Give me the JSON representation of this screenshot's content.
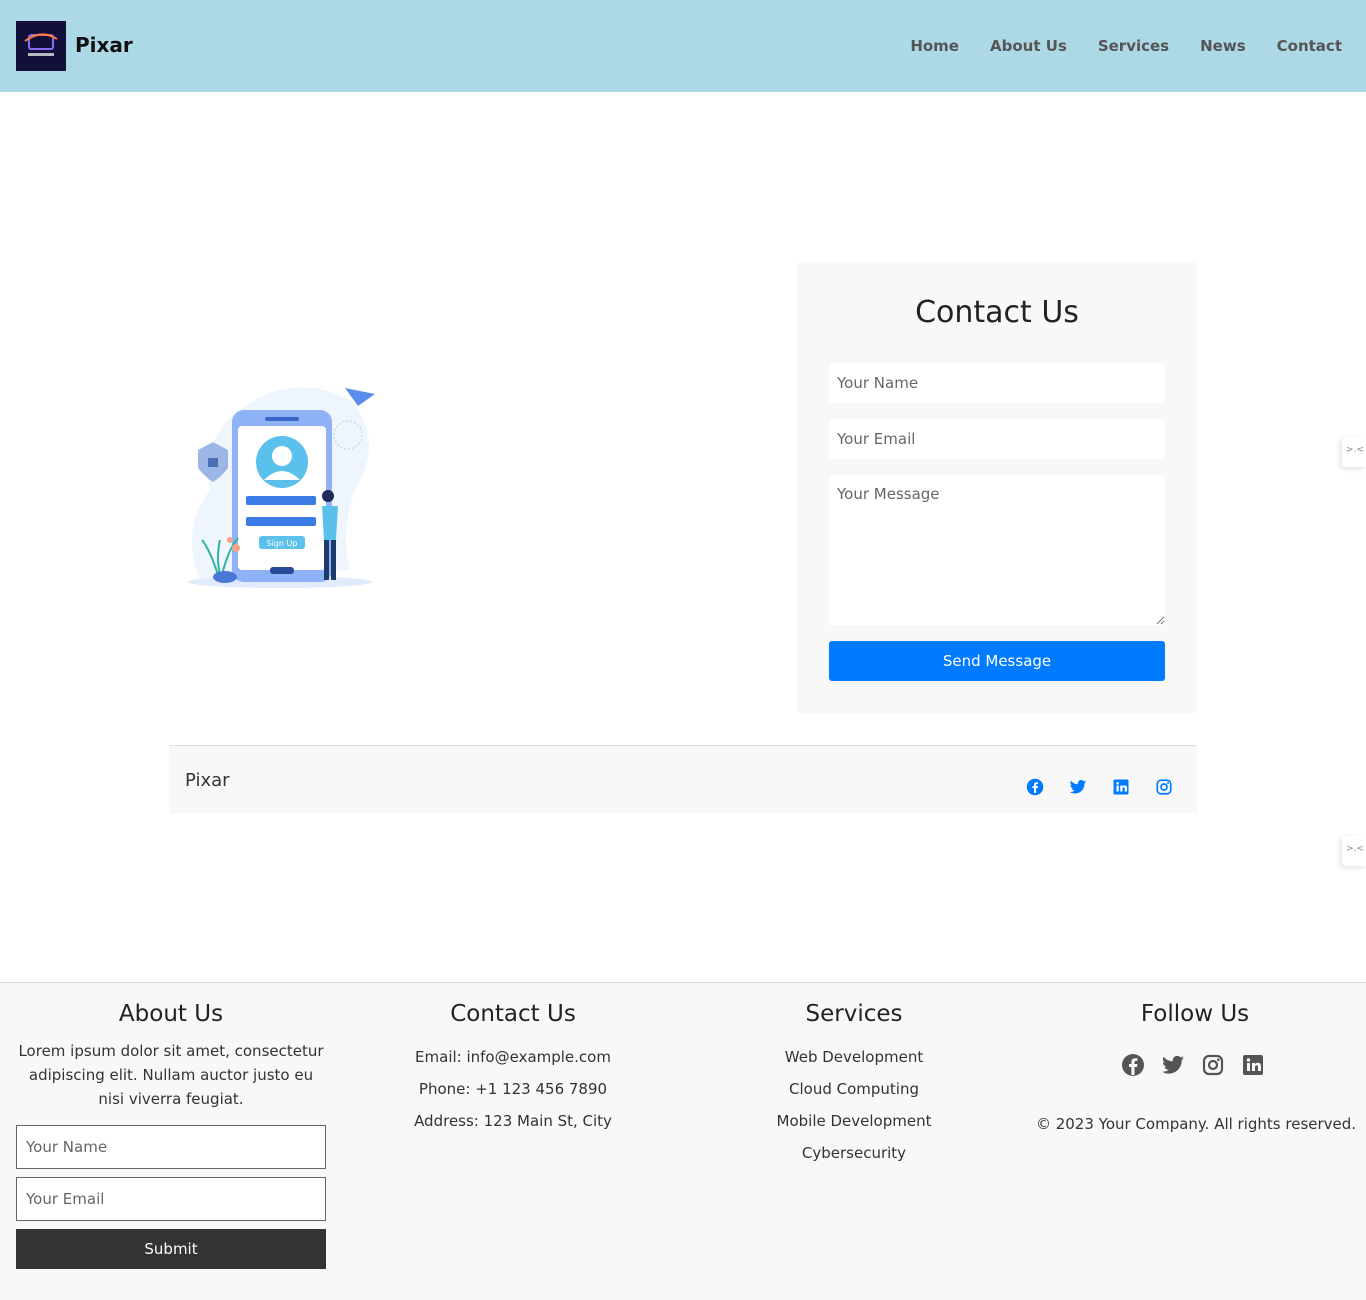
{
  "header": {
    "brand": "Pixar",
    "nav": [
      "Home",
      "About Us",
      "Services",
      "News",
      "Contact"
    ]
  },
  "illustration": {
    "signup_label": "Sign Up"
  },
  "contact_form": {
    "title": "Contact Us",
    "name_placeholder": "Your Name",
    "email_placeholder": "Your Email",
    "message_placeholder": "Your Message",
    "send_label": "Send Message"
  },
  "midbar": {
    "brand": "Pixar",
    "icons": [
      "facebook-icon",
      "twitter-icon",
      "linkedin-icon",
      "instagram-icon"
    ]
  },
  "footer": {
    "about": {
      "title": "About Us",
      "text": "Lorem ipsum dolor sit amet, consectetur adipiscing elit. Nullam auctor justo eu nisi viverra feugiat.",
      "name_placeholder": "Your Name",
      "email_placeholder": "Your Email",
      "submit_label": "Submit"
    },
    "contact": {
      "title": "Contact Us",
      "email": "Email: info@example.com",
      "phone": "Phone: +1 123 456 7890",
      "address": "Address: 123 Main St, City"
    },
    "services": {
      "title": "Services",
      "items": [
        "Web Development",
        "Cloud Computing",
        "Mobile Development",
        "Cybersecurity"
      ]
    },
    "follow": {
      "title": "Follow Us",
      "icons": [
        "facebook-icon",
        "twitter-icon",
        "instagram-icon",
        "linkedin-icon"
      ],
      "copyright": "© 2023 Your Company. All rights reserved."
    }
  },
  "colors": {
    "header_bg": "#add8e6",
    "primary": "#007bff",
    "dark_button": "#333333",
    "panel_bg": "#f8f8f8"
  }
}
